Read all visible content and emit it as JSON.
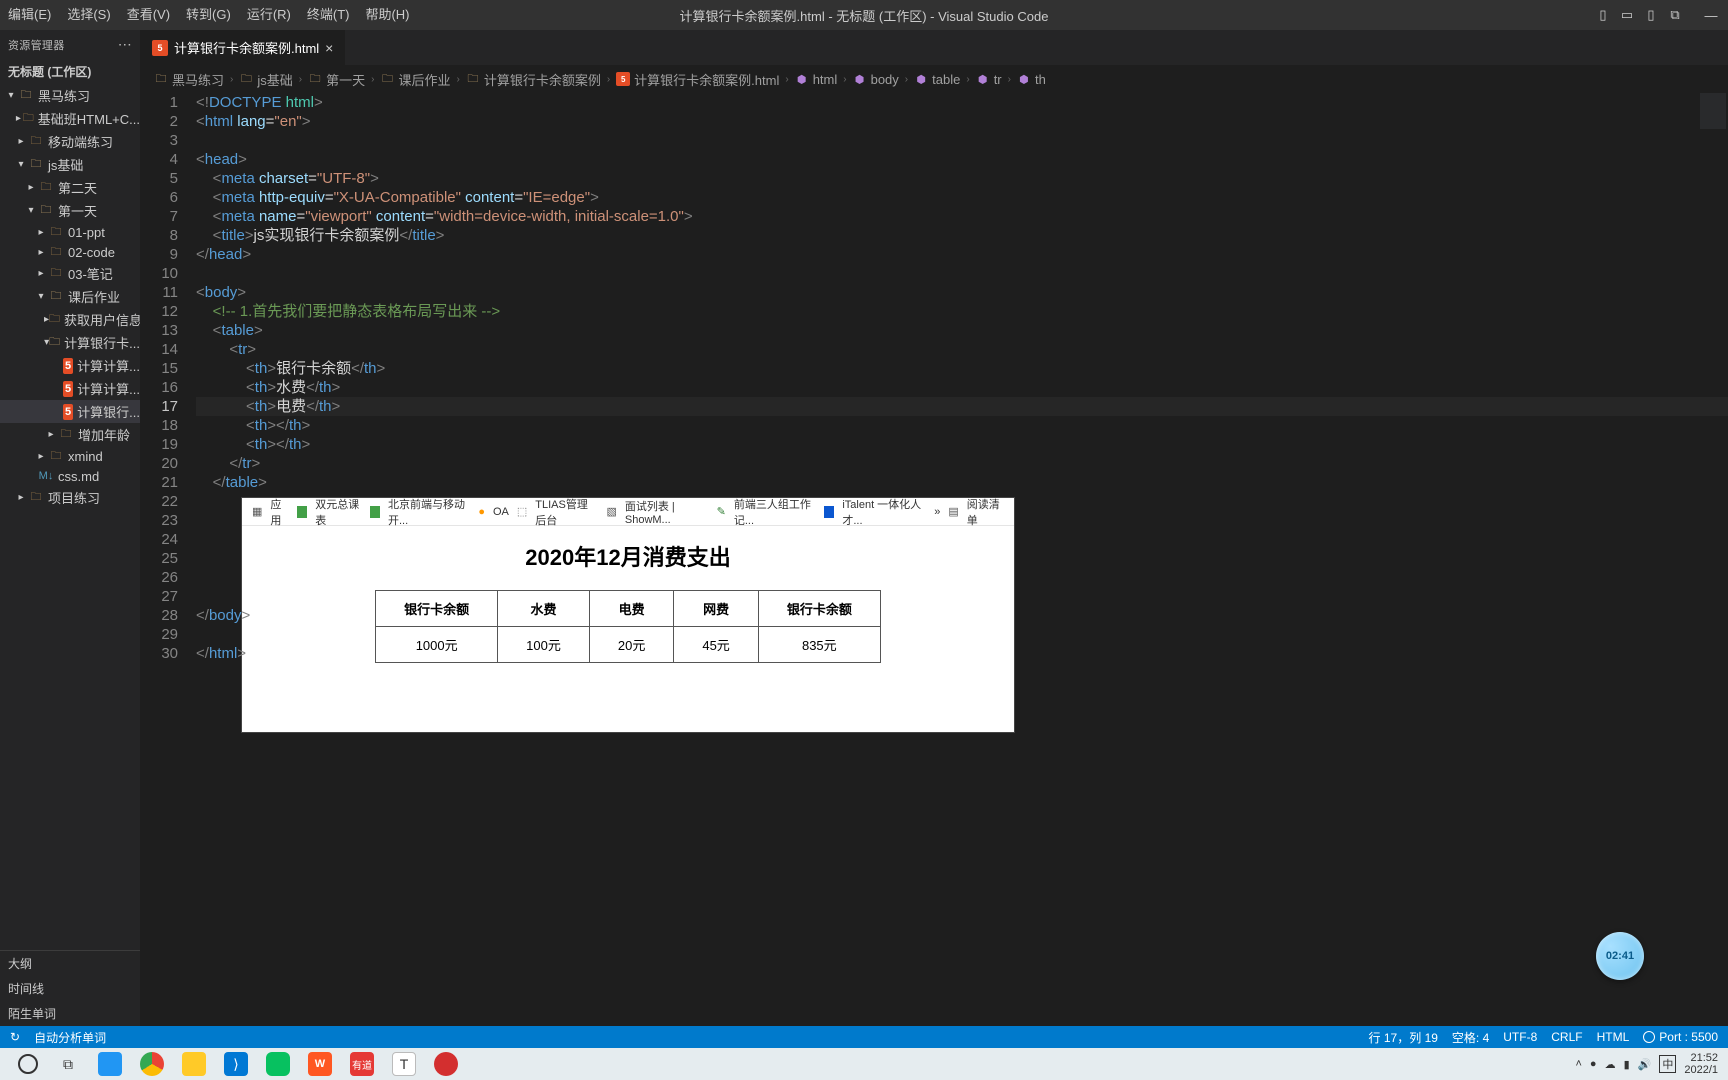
{
  "menu": {
    "items": [
      "编辑(E)",
      "选择(S)",
      "查看(V)",
      "转到(G)",
      "运行(R)",
      "终端(T)",
      "帮助(H)"
    ],
    "title": "计算银行卡余额案例.html - 无标题 (工作区) - Visual Studio Code"
  },
  "sidebar": {
    "head": "资源管理器",
    "workspace": "无标题 (工作区)",
    "tree": [
      {
        "d": 0,
        "tw": "expanded",
        "icon": "fold-open",
        "label": "黑马练习"
      },
      {
        "d": 1,
        "tw": "collapsed",
        "icon": "fold-closed",
        "label": "基础班HTML+C..."
      },
      {
        "d": 1,
        "tw": "collapsed",
        "icon": "fold-closed",
        "label": "移动端练习"
      },
      {
        "d": 1,
        "tw": "expanded",
        "icon": "fold-open",
        "label": "js基础"
      },
      {
        "d": 2,
        "tw": "collapsed",
        "icon": "fold-closed",
        "label": "第二天"
      },
      {
        "d": 2,
        "tw": "expanded",
        "icon": "fold-open",
        "label": "第一天"
      },
      {
        "d": 3,
        "tw": "collapsed",
        "icon": "fold-closed",
        "label": "01-ppt"
      },
      {
        "d": 3,
        "tw": "collapsed",
        "icon": "fold-closed",
        "label": "02-code"
      },
      {
        "d": 3,
        "tw": "collapsed",
        "icon": "fold-closed",
        "label": "03-笔记"
      },
      {
        "d": 3,
        "tw": "expanded",
        "icon": "fold-open",
        "label": "课后作业"
      },
      {
        "d": 4,
        "tw": "collapsed",
        "icon": "fold-closed",
        "label": "获取用户信息"
      },
      {
        "d": 4,
        "tw": "expanded",
        "icon": "fold-open",
        "label": "计算银行卡...",
        "sel": false
      },
      {
        "d": 5,
        "tw": "",
        "icon": "html",
        "label": "计算计算..."
      },
      {
        "d": 5,
        "tw": "",
        "icon": "html",
        "label": "计算计算..."
      },
      {
        "d": 5,
        "tw": "",
        "icon": "html",
        "label": "计算银行...",
        "sel": true
      },
      {
        "d": 4,
        "tw": "collapsed",
        "icon": "fold-closed",
        "label": "增加年龄"
      },
      {
        "d": 3,
        "tw": "collapsed",
        "icon": "fold-closed",
        "label": "xmind"
      },
      {
        "d": 2,
        "tw": "",
        "icon": "md",
        "label": "css.md"
      },
      {
        "d": 1,
        "tw": "collapsed",
        "icon": "fold-closed",
        "label": "项目练习"
      }
    ],
    "bottom": [
      "大纲",
      "时间线",
      "陌生单词"
    ]
  },
  "tab": {
    "label": "计算银行卡余额案例.html"
  },
  "breadcrumb": [
    "黑马练习",
    "js基础",
    "第一天",
    "课后作业",
    "计算银行卡余额案例",
    "计算银行卡余额案例.html",
    "html",
    "body",
    "table",
    "tr",
    "th"
  ],
  "code_raw": "<!DOCTYPE html>\n<html lang=\"en\">\n\n<head>\n    <meta charset=\"UTF-8\">\n    <meta http-equiv=\"X-UA-Compatible\" content=\"IE=edge\">\n    <meta name=\"viewport\" content=\"width=device-width, initial-scale=1.0\">\n    <title>js实现银行卡余额案例</title>\n</head>\n\n<body>\n    <!-- 1.首先我们要把静态表格布局写出来 -->\n    <table>\n        <tr>\n            <th>银行卡余额</th>\n            <th>水费</th>\n            <th>电费</th>\n            <th></th>\n            <th></th>\n        </tr>\n    </table>\n\n\n\n\n\n\n</body>\n\n</html>",
  "current_line": 17,
  "code_lines": {
    "1": [
      [
        "p-gray",
        "<!"
      ],
      [
        "p-doc",
        "DOCTYPE "
      ],
      [
        "p-doc2",
        "html"
      ],
      [
        "p-gray",
        ">"
      ]
    ],
    "2": [
      [
        "p-gray",
        "<"
      ],
      [
        "p-tag",
        "html "
      ],
      [
        "p-attr",
        "lang"
      ],
      [
        "p-txt",
        "="
      ],
      [
        "p-str",
        "\"en\""
      ],
      [
        "p-gray",
        ">"
      ]
    ],
    "3": [],
    "4": [
      [
        "p-gray",
        "<"
      ],
      [
        "p-tag",
        "head"
      ],
      [
        "p-gray",
        ">"
      ]
    ],
    "5": [
      [
        "",
        "    "
      ],
      [
        "p-gray",
        "<"
      ],
      [
        "p-tag",
        "meta "
      ],
      [
        "p-attr",
        "charset"
      ],
      [
        "p-txt",
        "="
      ],
      [
        "p-str",
        "\"UTF-8\""
      ],
      [
        "p-gray",
        ">"
      ]
    ],
    "6": [
      [
        "",
        "    "
      ],
      [
        "p-gray",
        "<"
      ],
      [
        "p-tag",
        "meta "
      ],
      [
        "p-attr",
        "http-equiv"
      ],
      [
        "p-txt",
        "="
      ],
      [
        "p-str",
        "\"X-UA-Compatible\" "
      ],
      [
        "p-attr",
        "content"
      ],
      [
        "p-txt",
        "="
      ],
      [
        "p-str",
        "\"IE=edge\""
      ],
      [
        "p-gray",
        ">"
      ]
    ],
    "7": [
      [
        "",
        "    "
      ],
      [
        "p-gray",
        "<"
      ],
      [
        "p-tag",
        "meta "
      ],
      [
        "p-attr",
        "name"
      ],
      [
        "p-txt",
        "="
      ],
      [
        "p-str",
        "\"viewport\" "
      ],
      [
        "p-attr",
        "content"
      ],
      [
        "p-txt",
        "="
      ],
      [
        "p-str",
        "\"width=device-width, initial-scale=1.0\""
      ],
      [
        "p-gray",
        ">"
      ]
    ],
    "8": [
      [
        "",
        "    "
      ],
      [
        "p-gray",
        "<"
      ],
      [
        "p-tag",
        "title"
      ],
      [
        "p-gray",
        ">"
      ],
      [
        "p-txt",
        "js实现银行卡余额案例"
      ],
      [
        "p-gray",
        "</"
      ],
      [
        "p-tag",
        "title"
      ],
      [
        "p-gray",
        ">"
      ]
    ],
    "9": [
      [
        "p-gray",
        "</"
      ],
      [
        "p-tag",
        "head"
      ],
      [
        "p-gray",
        ">"
      ]
    ],
    "10": [],
    "11": [
      [
        "p-gray",
        "<"
      ],
      [
        "p-tag",
        "body"
      ],
      [
        "p-gray",
        ">"
      ]
    ],
    "12": [
      [
        "",
        "    "
      ],
      [
        "p-com",
        "<!-- 1.首先我们要把静态表格布局写出来 -->"
      ]
    ],
    "13": [
      [
        "",
        "    "
      ],
      [
        "p-gray",
        "<"
      ],
      [
        "p-tag",
        "table"
      ],
      [
        "p-gray",
        ">"
      ]
    ],
    "14": [
      [
        "",
        "        "
      ],
      [
        "p-gray",
        "<"
      ],
      [
        "p-tag",
        "tr"
      ],
      [
        "p-gray",
        ">"
      ]
    ],
    "15": [
      [
        "",
        "            "
      ],
      [
        "p-gray",
        "<"
      ],
      [
        "p-tag",
        "th"
      ],
      [
        "p-gray",
        ">"
      ],
      [
        "p-txt",
        "银行卡余额"
      ],
      [
        "p-gray",
        "</"
      ],
      [
        "p-tag",
        "th"
      ],
      [
        "p-gray",
        ">"
      ]
    ],
    "16": [
      [
        "",
        "            "
      ],
      [
        "p-gray",
        "<"
      ],
      [
        "p-tag",
        "th"
      ],
      [
        "p-gray",
        ">"
      ],
      [
        "p-txt",
        "水费"
      ],
      [
        "p-gray",
        "</"
      ],
      [
        "p-tag",
        "th"
      ],
      [
        "p-gray",
        ">"
      ]
    ],
    "17": [
      [
        "",
        "            "
      ],
      [
        "p-gray",
        "<"
      ],
      [
        "p-tag",
        "th"
      ],
      [
        "p-gray",
        ">"
      ],
      [
        "p-txt",
        "电费"
      ],
      [
        "p-gray",
        "</"
      ],
      [
        "p-tag",
        "th"
      ],
      [
        "p-gray",
        ">"
      ]
    ],
    "18": [
      [
        "",
        "            "
      ],
      [
        "p-gray",
        "<"
      ],
      [
        "p-tag",
        "th"
      ],
      [
        "p-gray",
        "></"
      ],
      [
        "p-tag",
        "th"
      ],
      [
        "p-gray",
        ">"
      ]
    ],
    "19": [
      [
        "",
        "            "
      ],
      [
        "p-gray",
        "<"
      ],
      [
        "p-tag",
        "th"
      ],
      [
        "p-gray",
        "></"
      ],
      [
        "p-tag",
        "th"
      ],
      [
        "p-gray",
        ">"
      ]
    ],
    "20": [
      [
        "",
        "        "
      ],
      [
        "p-gray",
        "</"
      ],
      [
        "p-tag",
        "tr"
      ],
      [
        "p-gray",
        ">"
      ]
    ],
    "21": [
      [
        "",
        "    "
      ],
      [
        "p-gray",
        "</"
      ],
      [
        "p-tag",
        "table"
      ],
      [
        "p-gray",
        ">"
      ]
    ],
    "22": [],
    "23": [],
    "24": [],
    "25": [],
    "26": [],
    "27": [],
    "28": [
      [
        "p-gray",
        "</"
      ],
      [
        "p-tag",
        "body"
      ],
      [
        "p-gray",
        ">"
      ]
    ],
    "29": [],
    "30": [
      [
        "p-gray",
        "</"
      ],
      [
        "p-tag",
        "html"
      ],
      [
        "p-gray",
        ">"
      ]
    ]
  },
  "preview": {
    "bookmarks": [
      "应用",
      "双元总课表",
      "北京前端与移动开...",
      "OA",
      "TLIAS管理后台",
      "面试列表 | ShowM...",
      "前端三人组工作记...",
      "iTalent 一体化人才...",
      "»",
      "阅读清单"
    ],
    "title": "2020年12月消费支出",
    "headers": [
      "银行卡余额",
      "水费",
      "电费",
      "网费",
      "银行卡余额"
    ],
    "row": [
      "1000元",
      "100元",
      "20元",
      "45元",
      "835元"
    ]
  },
  "badge": "02:41",
  "status": {
    "left_icon": "↻",
    "left_text": "自动分析单词",
    "right": [
      "行 17，列 19",
      "空格: 4",
      "UTF-8",
      "CRLF",
      "HTML",
      "Port : 5500"
    ]
  },
  "taskbar": {
    "clock": "21:52",
    "date": "2022/1",
    "ime": "中"
  }
}
